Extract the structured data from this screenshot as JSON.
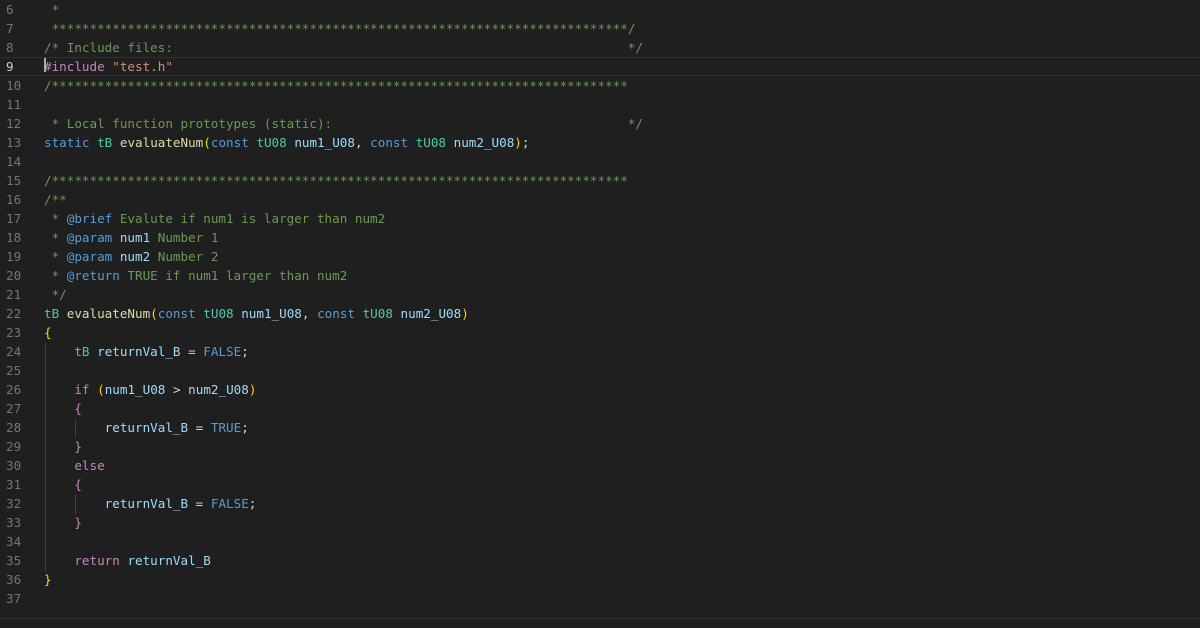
{
  "editor": {
    "language": "c",
    "colors": {
      "background": "#1f1f1f",
      "line_number": "#6e7681",
      "current_line_number": "#cccccc",
      "comment": "#6a9955",
      "keyword": "#569cd6",
      "control": "#c586c0",
      "type": "#4ec9b0",
      "string": "#ce9178",
      "variable": "#9cdcfe",
      "function": "#dcdcaa",
      "brace": "#ffd700"
    },
    "lines": [
      {
        "num": "6",
        "text": " *"
      },
      {
        "num": "7",
        "text": " ****************************************************************************/"
      },
      {
        "num": "8",
        "text": "/* Include files:                                                            */"
      },
      {
        "num": "9",
        "text": "#include \"test.h\""
      },
      {
        "num": "10",
        "text": "/****************************************************************************"
      },
      {
        "num": "11",
        "text": ""
      },
      {
        "num": "12",
        "text": " * Local function prototypes (static):                                       */"
      },
      {
        "num": "13",
        "text": "static tB evaluateNum(const tU08 num1_U08, const tU08 num2_U08);"
      },
      {
        "num": "14",
        "text": ""
      },
      {
        "num": "15",
        "text": "/****************************************************************************"
      },
      {
        "num": "16",
        "text": "/**"
      },
      {
        "num": "17",
        "text": " * @brief Evalute if num1 is larger than num2"
      },
      {
        "num": "18",
        "text": " * @param num1 Number 1"
      },
      {
        "num": "19",
        "text": " * @param num2 Number 2"
      },
      {
        "num": "20",
        "text": " * @return TRUE if num1 larger than num2"
      },
      {
        "num": "21",
        "text": " */"
      },
      {
        "num": "22",
        "text": "tB evaluateNum(const tU08 num1_U08, const tU08 num2_U08)"
      },
      {
        "num": "23",
        "text": "{"
      },
      {
        "num": "24",
        "text": "    tB returnVal_B = FALSE;"
      },
      {
        "num": "25",
        "text": ""
      },
      {
        "num": "26",
        "text": "    if (num1_U08 > num2_U08)"
      },
      {
        "num": "27",
        "text": "    {"
      },
      {
        "num": "28",
        "text": "        returnVal_B = TRUE;"
      },
      {
        "num": "29",
        "text": "    }"
      },
      {
        "num": "30",
        "text": "    else"
      },
      {
        "num": "31",
        "text": "    {"
      },
      {
        "num": "32",
        "text": "        returnVal_B = FALSE;"
      },
      {
        "num": "33",
        "text": "    }"
      },
      {
        "num": "34",
        "text": ""
      },
      {
        "num": "35",
        "text": "    return returnVal_B"
      },
      {
        "num": "36",
        "text": "}"
      },
      {
        "num": "37",
        "text": ""
      }
    ],
    "current_line": "9"
  }
}
